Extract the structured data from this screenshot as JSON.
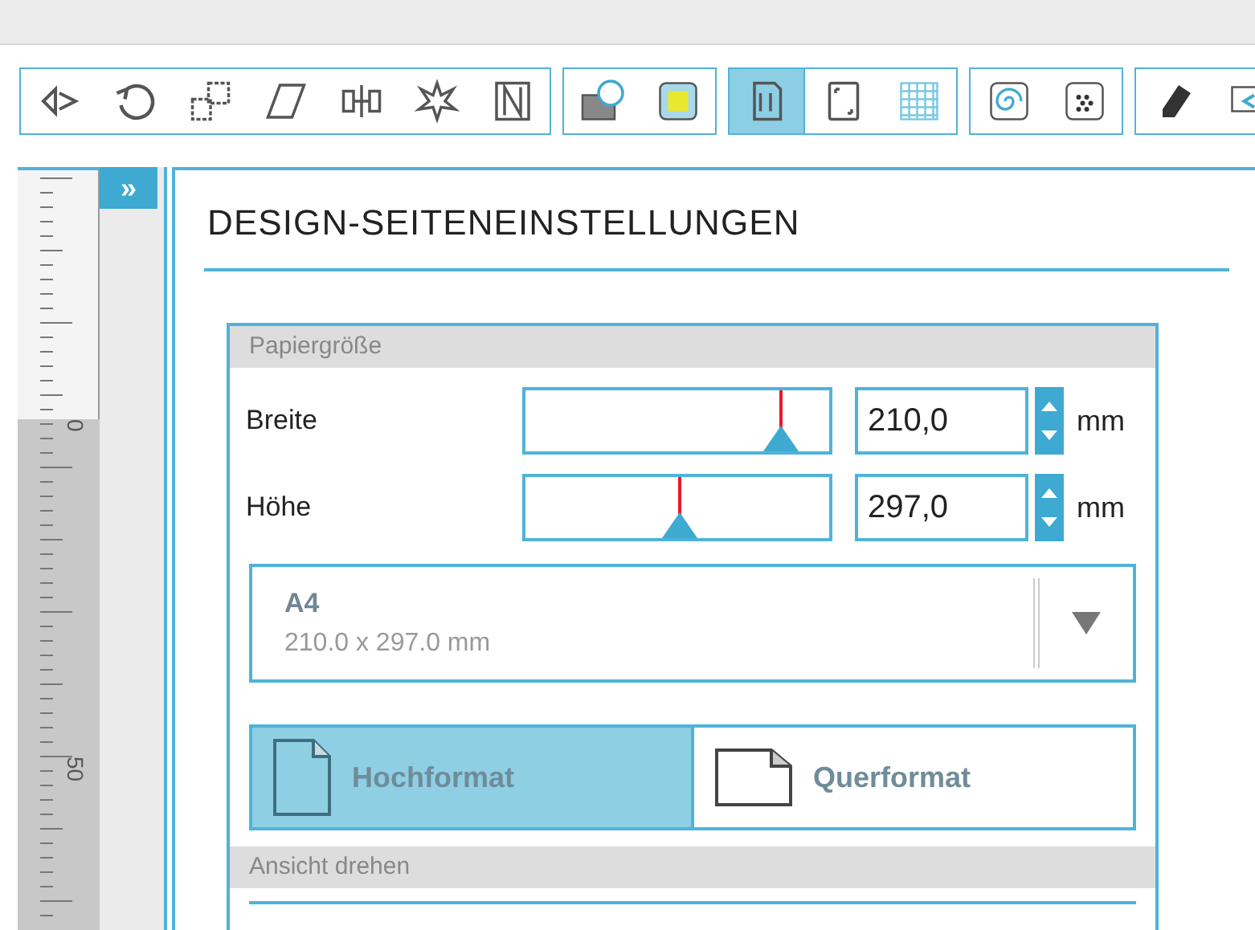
{
  "toolbar": {
    "groups": [
      {
        "items": [
          {
            "selected": false
          },
          {
            "selected": false
          },
          {
            "selected": false
          },
          {
            "selected": false
          },
          {
            "selected": false
          },
          {
            "selected": false
          },
          {
            "selected": false
          }
        ]
      },
      {
        "items": [
          {
            "selected": false
          },
          {
            "selected": false
          }
        ]
      },
      {
        "items": [
          {
            "selected": true
          },
          {
            "selected": false
          },
          {
            "selected": false
          }
        ]
      },
      {
        "items": [
          {
            "selected": false
          },
          {
            "selected": false
          }
        ]
      },
      {
        "items": [
          {
            "selected": false
          },
          {
            "selected": false
          }
        ]
      }
    ]
  },
  "ruler": {
    "labels": [
      "0",
      "50"
    ]
  },
  "expand_button": {
    "label": "»"
  },
  "panel": {
    "title": "DESIGN-SEITENEINSTELLUNGEN",
    "paper_size": {
      "header": "Papiergröße",
      "fields": [
        {
          "label": "Breite",
          "level": 0.84,
          "value": "210,0",
          "unit": "mm"
        },
        {
          "label": "Höhe",
          "level": 0.51,
          "value": "297,0",
          "unit": "mm"
        }
      ],
      "preset": {
        "name": "A4",
        "size": "210.0 x 297.0 mm"
      },
      "orientations": [
        {
          "label": "Hochformat",
          "selected": true
        },
        {
          "label": "Querformat",
          "selected": false
        }
      ]
    },
    "rotate_view": {
      "header": "Ansicht drehen"
    }
  }
}
